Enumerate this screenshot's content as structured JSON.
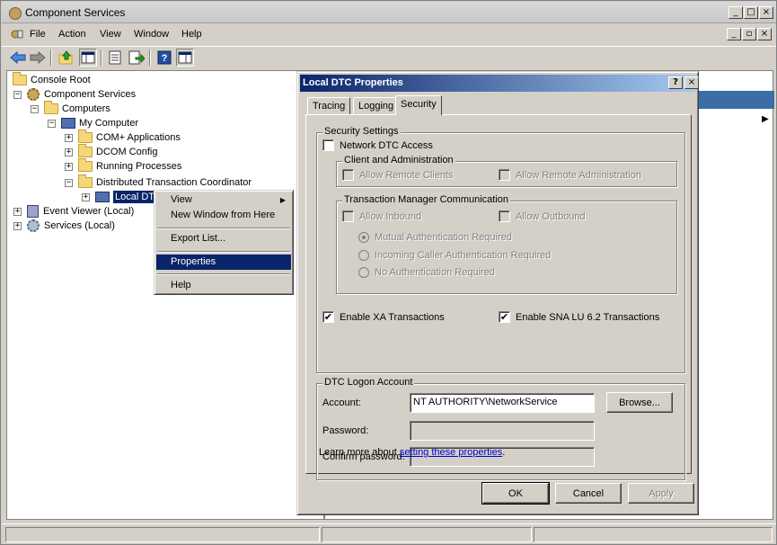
{
  "window": {
    "title": "Component Services",
    "caption_buttons": [
      "_",
      "□",
      "×"
    ],
    "doc_caption_buttons": [
      "_",
      "▫",
      "×"
    ]
  },
  "menu": {
    "items": [
      "File",
      "Action",
      "View",
      "Window",
      "Help"
    ]
  },
  "toolbar": {
    "icons": [
      "back-icon",
      "forward-icon",
      "up-icon",
      "show-tree-icon",
      "properties-icon",
      "export-icon",
      "help-icon",
      "console-tree-icon"
    ]
  },
  "tree": {
    "items": [
      {
        "label": "Console Root",
        "icon": "folder-icon"
      },
      {
        "label": "Component Services",
        "icon": "gear-icon",
        "expander": "−"
      },
      {
        "label": "Computers",
        "icon": "folder-icon",
        "expander": "−"
      },
      {
        "label": "My Computer",
        "icon": "computer-icon",
        "expander": "−"
      },
      {
        "label": "COM+ Applications",
        "icon": "folder-icon",
        "expander": "+"
      },
      {
        "label": "DCOM Config",
        "icon": "folder-icon",
        "expander": "+"
      },
      {
        "label": "Running Processes",
        "icon": "folder-icon",
        "expander": "+"
      },
      {
        "label": "Distributed Transaction Coordinator",
        "icon": "folder-icon",
        "expander": "−"
      },
      {
        "label": "Local DTC",
        "icon": "computer-icon",
        "expander": "+"
      },
      {
        "label": "Event Viewer (Local)",
        "icon": "event-viewer-icon",
        "expander": "+"
      },
      {
        "label": "Services (Local)",
        "icon": "services-icon",
        "expander": "+"
      }
    ]
  },
  "context_menu": {
    "view": "View",
    "new_window": "New Window from Here",
    "export_list": "Export List...",
    "properties": "Properties",
    "help": "Help"
  },
  "dialog": {
    "title": "Local DTC Properties",
    "help_btn": "?",
    "close_btn": "×",
    "tabs": [
      "Tracing",
      "Logging",
      "Security"
    ],
    "active_tab": "Security",
    "security_settings": {
      "label": "Security Settings",
      "network_dtc_access": "Network DTC Access",
      "network_dtc_access_checked": false
    },
    "client_admin": {
      "label": "Client and Administration",
      "allow_remote_clients": "Allow Remote Clients",
      "allow_remote_admin": "Allow Remote Administration"
    },
    "tm_comm": {
      "label": "Transaction Manager Communication",
      "allow_inbound": "Allow Inbound",
      "allow_outbound": "Allow Outbound",
      "mutual_auth": "Mutual Authentication Required",
      "incoming_caller_auth": "Incoming Caller Authentication Required",
      "no_auth": "No Authentication Required",
      "selected_auth": "Mutual Authentication Required"
    },
    "enable_xa": "Enable XA Transactions",
    "enable_xa_checked": true,
    "enable_sna": "Enable SNA LU 6.2 Transactions",
    "enable_sna_checked": true,
    "check_mark": "✔",
    "logon": {
      "label": "DTC Logon Account",
      "account_label": "Account:",
      "account_value": "NT AUTHORITY\\NetworkService",
      "browse": "Browse...",
      "password_label": "Password:",
      "confirm_label": "Confirm password:"
    },
    "learn_more_prefix": "Learn more about ",
    "learn_more_link": "setting these properties",
    "learn_more_suffix": ".",
    "ok": "OK",
    "cancel": "Cancel",
    "apply": "Apply"
  },
  "colors": {
    "selection": "#0a246a",
    "title_gradient_start": "#0a246a",
    "title_gradient_end": "#a6caf0",
    "link": "#0000cc"
  }
}
